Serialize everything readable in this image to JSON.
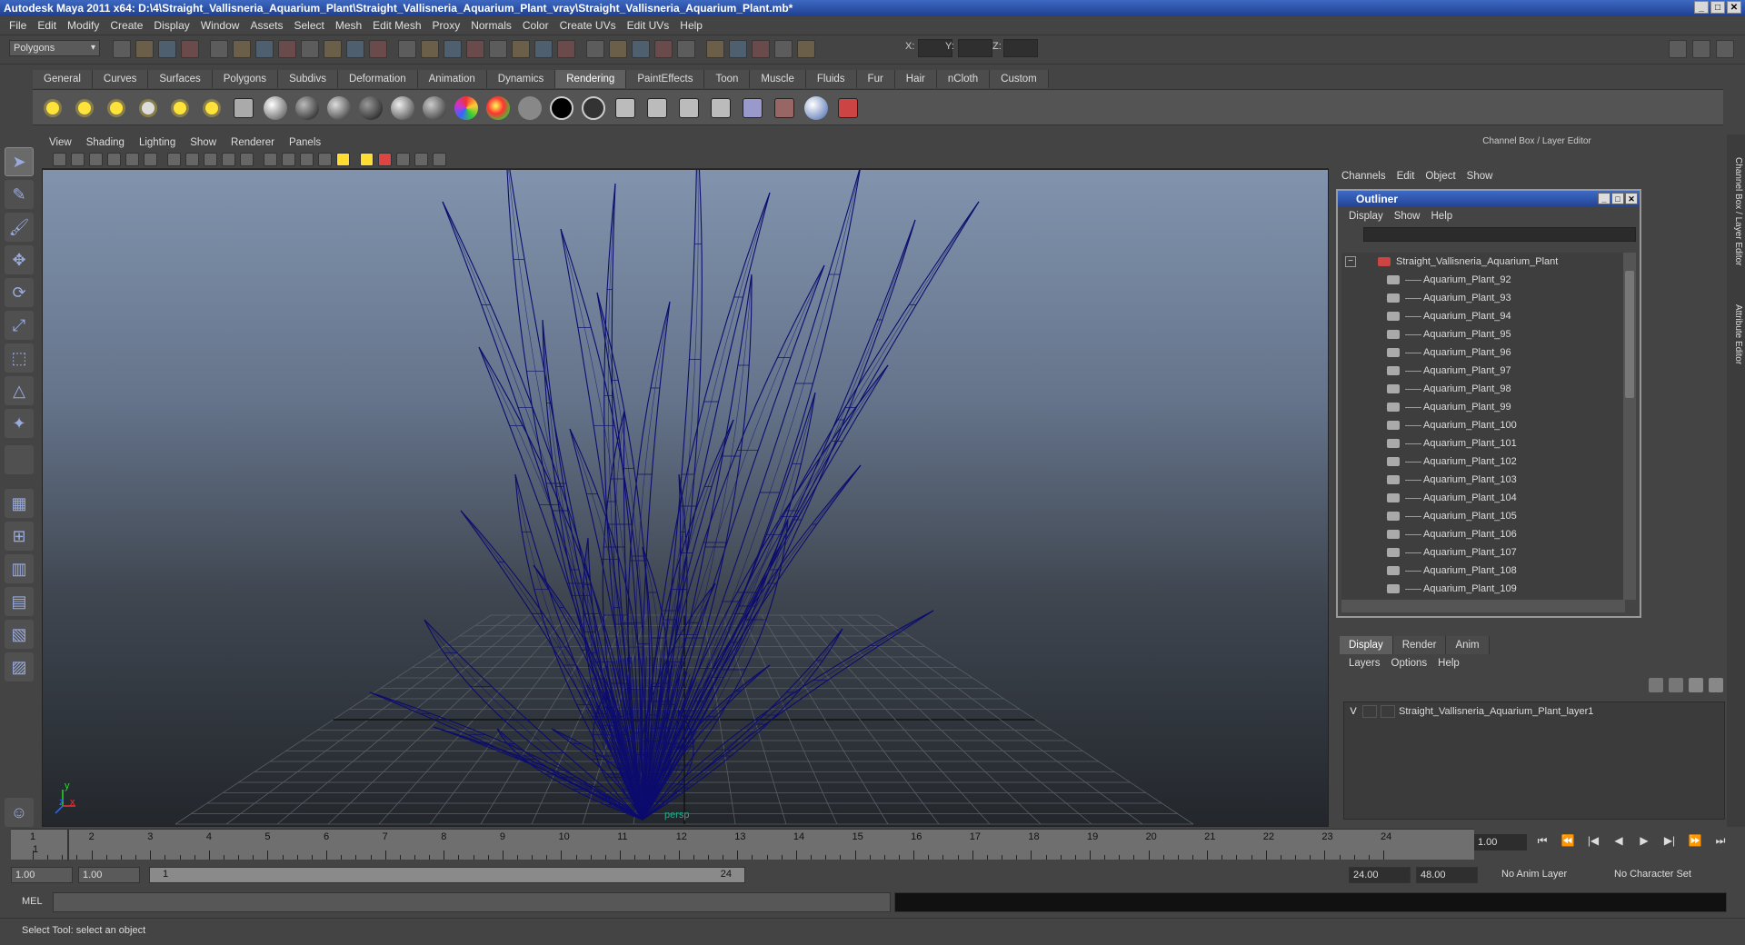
{
  "window": {
    "title": "Autodesk Maya 2011 x64: D:\\4\\Straight_Vallisneria_Aquarium_Plant\\Straight_Vallisneria_Aquarium_Plant_vray\\Straight_Vallisneria_Aquarium_Plant.mb*"
  },
  "menubar": {
    "items": [
      "File",
      "Edit",
      "Modify",
      "Create",
      "Display",
      "Window",
      "Assets",
      "Select",
      "Mesh",
      "Edit Mesh",
      "Proxy",
      "Normals",
      "Color",
      "Create UVs",
      "Edit UVs",
      "Help"
    ]
  },
  "statusline": {
    "mode": "Polygons",
    "x_label": "X:",
    "y_label": "Y:",
    "z_label": "Z:"
  },
  "shelf": {
    "tabs": [
      "General",
      "Curves",
      "Surfaces",
      "Polygons",
      "Subdivs",
      "Deformation",
      "Animation",
      "Dynamics",
      "Rendering",
      "PaintEffects",
      "Toon",
      "Muscle",
      "Fluids",
      "Fur",
      "Hair",
      "nCloth",
      "Custom"
    ],
    "active_tab": "Rendering"
  },
  "viewport": {
    "menu": [
      "View",
      "Shading",
      "Lighting",
      "Show",
      "Renderer",
      "Panels"
    ],
    "camera_label": "persp",
    "axis_y": "y",
    "axis_x": "x",
    "axis_z": "z",
    "wire_color": "#0c0c6e"
  },
  "channelbox": {
    "header": "Channel Box / Layer Editor",
    "menu": [
      "Channels",
      "Edit",
      "Object",
      "Show"
    ]
  },
  "outliner": {
    "title": "Outliner",
    "menu": [
      "Display",
      "Show",
      "Help"
    ],
    "root": "Straight_Vallisneria_Aquarium_Plant",
    "items": [
      "Aquarium_Plant_92",
      "Aquarium_Plant_93",
      "Aquarium_Plant_94",
      "Aquarium_Plant_95",
      "Aquarium_Plant_96",
      "Aquarium_Plant_97",
      "Aquarium_Plant_98",
      "Aquarium_Plant_99",
      "Aquarium_Plant_100",
      "Aquarium_Plant_101",
      "Aquarium_Plant_102",
      "Aquarium_Plant_103",
      "Aquarium_Plant_104",
      "Aquarium_Plant_105",
      "Aquarium_Plant_106",
      "Aquarium_Plant_107",
      "Aquarium_Plant_108",
      "Aquarium_Plant_109"
    ]
  },
  "layers": {
    "tabs": [
      "Display",
      "Render",
      "Anim"
    ],
    "active_tab": "Display",
    "menu": [
      "Layers",
      "Options",
      "Help"
    ],
    "rows": [
      {
        "visible": "V",
        "name": "Straight_Vallisneria_Aquarium_Plant_layer1"
      }
    ]
  },
  "side_tabs": [
    "Channel Box / Layer Editor",
    "Attribute Editor"
  ],
  "timeline": {
    "start": 1,
    "end": 24,
    "current_frame_label": "1",
    "current_time": "1.00"
  },
  "range": {
    "start_time": "1.00",
    "playback_start": "1.00",
    "slider_start": "1",
    "slider_end": "24",
    "playback_end": "24.00",
    "end_time": "48.00",
    "anim_layer": "No Anim Layer",
    "character_set": "No Character Set"
  },
  "command": {
    "label": "MEL"
  },
  "status": {
    "help": "Select Tool: select an object"
  }
}
